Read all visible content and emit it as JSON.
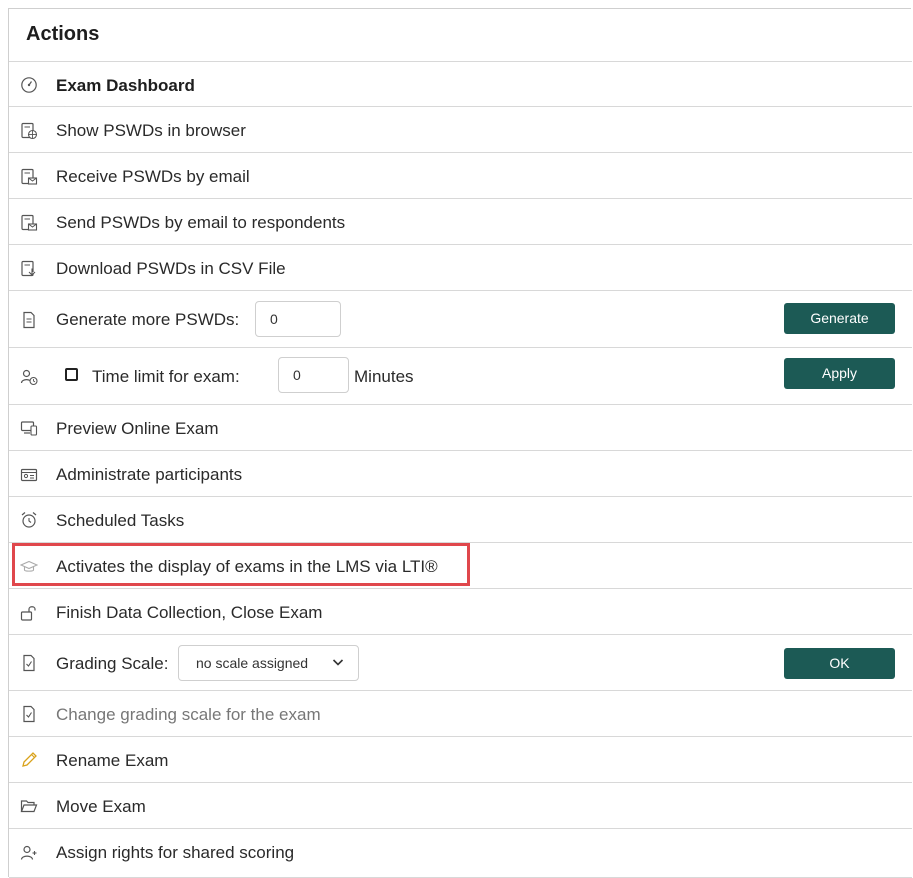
{
  "panel": {
    "title": "Actions"
  },
  "rows": {
    "dashboard": {
      "label": "Exam Dashboard",
      "icon": "gauge-icon"
    },
    "show_pswds": {
      "label": "Show PSWDs in browser",
      "icon": "document-globe-icon"
    },
    "receive_pswds": {
      "label": "Receive PSWDs by email",
      "icon": "document-mail-icon"
    },
    "send_pswds": {
      "label": "Send PSWDs by email to respondents",
      "icon": "document-send-icon"
    },
    "download_pswds": {
      "label": "Download PSWDs in CSV File",
      "icon": "document-download-icon"
    },
    "generate": {
      "label": "Generate more PSWDs:",
      "input_value": "0",
      "button": "Generate",
      "icon": "document-icon"
    },
    "time_limit": {
      "label": "Time limit for exam:",
      "input_value": "0",
      "unit": "Minutes",
      "button": "Apply",
      "checked": false,
      "icon": "user-clock-icon"
    },
    "preview": {
      "label": "Preview Online Exam",
      "icon": "preview-device-icon"
    },
    "participants": {
      "label": "Administrate participants",
      "icon": "id-card-icon"
    },
    "scheduled": {
      "label": "Scheduled Tasks",
      "icon": "alarm-clock-icon"
    },
    "lti": {
      "label": "Activates the display of exams in the LMS via LTI®",
      "icon": "graduation-cap-icon"
    },
    "finish": {
      "label": "Finish Data Collection, Close Exam",
      "icon": "unlock-icon"
    },
    "grading": {
      "label": "Grading Scale:",
      "select_value": "no scale assigned",
      "button": "OK",
      "icon": "document-check-icon"
    },
    "change_grading": {
      "label": "Change grading scale for the exam",
      "icon": "document-check-icon"
    },
    "rename": {
      "label": "Rename Exam",
      "icon": "pencil-icon"
    },
    "move": {
      "label": "Move Exam",
      "icon": "folder-open-icon"
    },
    "assign_rights": {
      "label": "Assign rights for shared scoring",
      "icon": "user-add-icon"
    }
  },
  "colors": {
    "button": "#1c5a55",
    "highlight": "#e0474c",
    "pencil": "#d9a21b"
  }
}
